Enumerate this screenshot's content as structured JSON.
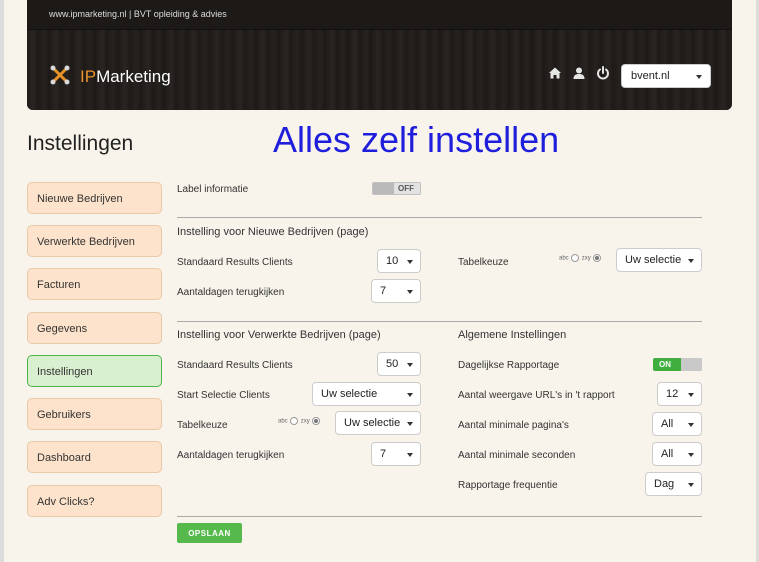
{
  "header": {
    "topbar_text": "www.ipmarketing.nl | BVT opleiding & advies",
    "logo_prefix": "IP",
    "logo_suffix": "Marketing",
    "domain_select": "bvent.nl"
  },
  "page_title": "Instellingen",
  "banner": "Alles zelf instellen",
  "sidebar": {
    "items": [
      {
        "label": "Nieuwe Bedrijven"
      },
      {
        "label": "Verwerkte Bedrijven"
      },
      {
        "label": "Facturen"
      },
      {
        "label": "Gegevens"
      },
      {
        "label": "Instellingen",
        "active": true
      },
      {
        "label": "Gebruikers"
      },
      {
        "label": "Dashboard"
      },
      {
        "label": "Adv Clicks?"
      }
    ]
  },
  "label_info": {
    "label": "Label informatie",
    "toggle": "OFF"
  },
  "section_new": {
    "title": "Instelling voor Nieuwe Bedrijven (page)",
    "results_label": "Standaard Results Clients",
    "results_value": "10",
    "days_label": "Aantaldagen terugkijken",
    "days_value": "7",
    "table_label": "Tabelkeuze",
    "radio_abc": "abc",
    "radio_zxy": "zxy",
    "table_value": "Uw selectie"
  },
  "section_processed": {
    "title": "Instelling voor Verwerkte Bedrijven (page)",
    "results_label": "Standaard Results Clients",
    "results_value": "50",
    "start_label": "Start Selectie Clients",
    "start_value": "Uw selectie",
    "table_label": "Tabelkeuze",
    "radio_abc": "abc",
    "radio_zxy": "zxy",
    "table_value": "Uw selectie",
    "days_label": "Aantaldagen terugkijken",
    "days_value": "7"
  },
  "section_general": {
    "title": "Algemene Instellingen",
    "daily_label": "Dagelijkse Rapportage",
    "daily_toggle": "ON",
    "urls_label": "Aantal weergave URL's in 't rapport",
    "urls_value": "12",
    "pages_label": "Aantal minimale pagina's",
    "pages_value": "All",
    "seconds_label": "Aantal minimale seconden",
    "seconds_value": "All",
    "freq_label": "Rapportage frequentie",
    "freq_value": "Dag"
  },
  "save_label": "OPSLAAN",
  "colors": {
    "accent_orange": "#e8922a",
    "toggle_green": "#3fae3f",
    "banner_blue": "#1e1edc"
  }
}
